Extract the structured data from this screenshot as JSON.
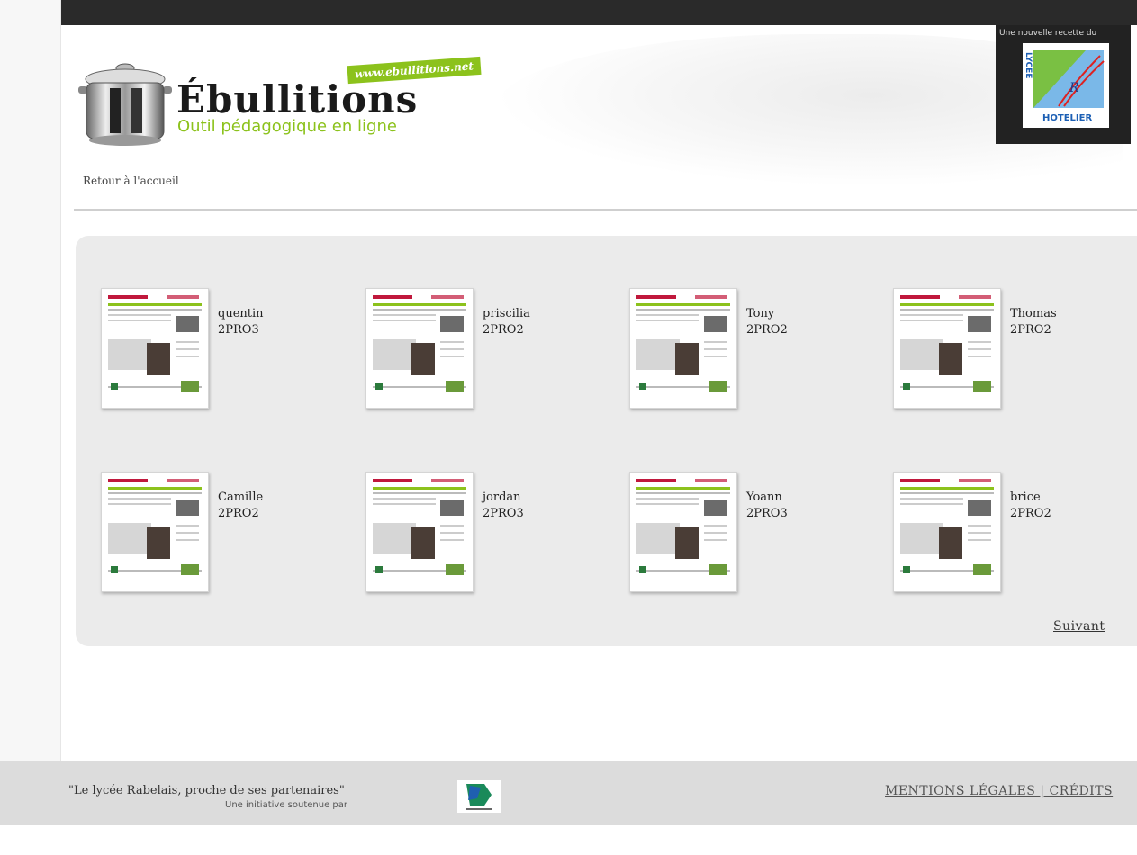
{
  "header": {
    "title": "Ébullitions",
    "subtitle": "Outil pédagogique en ligne",
    "url_badge": "www.ebullitions.net",
    "back_link": "Retour à l'accueil",
    "partner_caption": "Une nouvelle recette du",
    "partner_logo_text": {
      "vertical": "LYCEE",
      "horizontal": "HOTELIER"
    }
  },
  "cards": [
    {
      "name": "quentin",
      "class": "2PRO3"
    },
    {
      "name": "priscilia",
      "class": "2PRO2"
    },
    {
      "name": "Tony",
      "class": "2PRO2"
    },
    {
      "name": "Thomas",
      "class": "2PRO2"
    },
    {
      "name": "Camille",
      "class": "2PRO2"
    },
    {
      "name": "jordan",
      "class": "2PRO3"
    },
    {
      "name": "Yoann",
      "class": "2PRO3"
    },
    {
      "name": "brice",
      "class": "2PRO2"
    }
  ],
  "pagination": {
    "next_label": "Suivant"
  },
  "footer": {
    "quote": "\"Le lycée Rabelais, proche de ses partenaires\"",
    "support": "Une initiative soutenue par",
    "legal": "MENTIONS LÉGALES | CRÉDITS"
  },
  "colors": {
    "accent": "#8cc21c",
    "panel": "#ebebeb",
    "topbar": "#2a2a2a",
    "masthead_red": "#c0183c"
  }
}
